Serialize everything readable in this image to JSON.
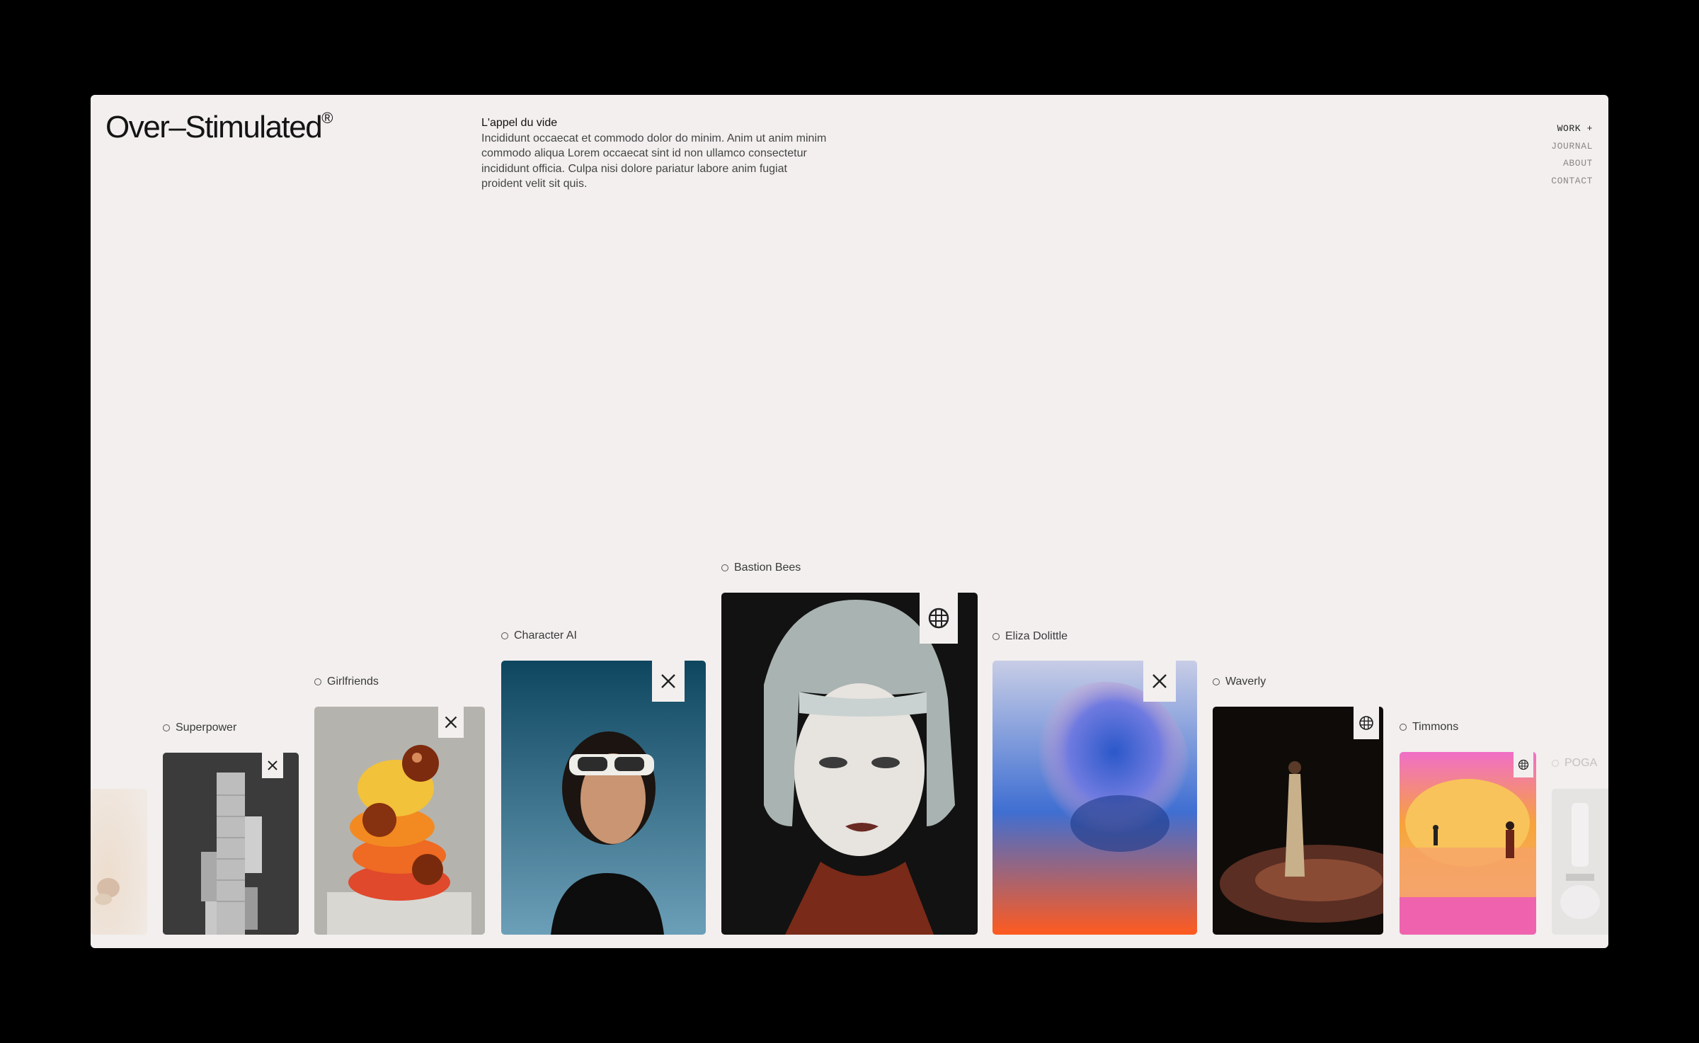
{
  "brand": {
    "name": "Over–Stimulated",
    "mark": "®"
  },
  "intro": {
    "title": "L'appel du vide",
    "body": "Incididunt occaecat et commodo dolor do minim. Anim ut anim minim commodo aliqua Lorem occaecat sint id non ullamco consectetur incididunt officia. Culpa nisi dolore pariatur labore anim fugiat proident velit sit quis."
  },
  "nav": {
    "work": "WORK +",
    "journal": "JOURNAL",
    "about": "ABOUT",
    "contact": "CONTACT"
  },
  "projects": [
    {
      "label": "Superpower",
      "badge": "cross-arrows-icon"
    },
    {
      "label": "Girlfriends",
      "badge": "cross-arrows-icon"
    },
    {
      "label": "Character AI",
      "badge": "cross-arrows-icon"
    },
    {
      "label": "Bastion Bees",
      "badge": "globe-icon"
    },
    {
      "label": "Eliza Dolittle",
      "badge": "cross-arrows-icon"
    },
    {
      "label": "Waverly",
      "badge": "globe-icon"
    },
    {
      "label": "Timmons",
      "badge": "globe-icon"
    },
    {
      "label": "POGA"
    }
  ],
  "colors": {
    "background": "#f2efee",
    "frame": "#000000",
    "text": "#141414"
  }
}
